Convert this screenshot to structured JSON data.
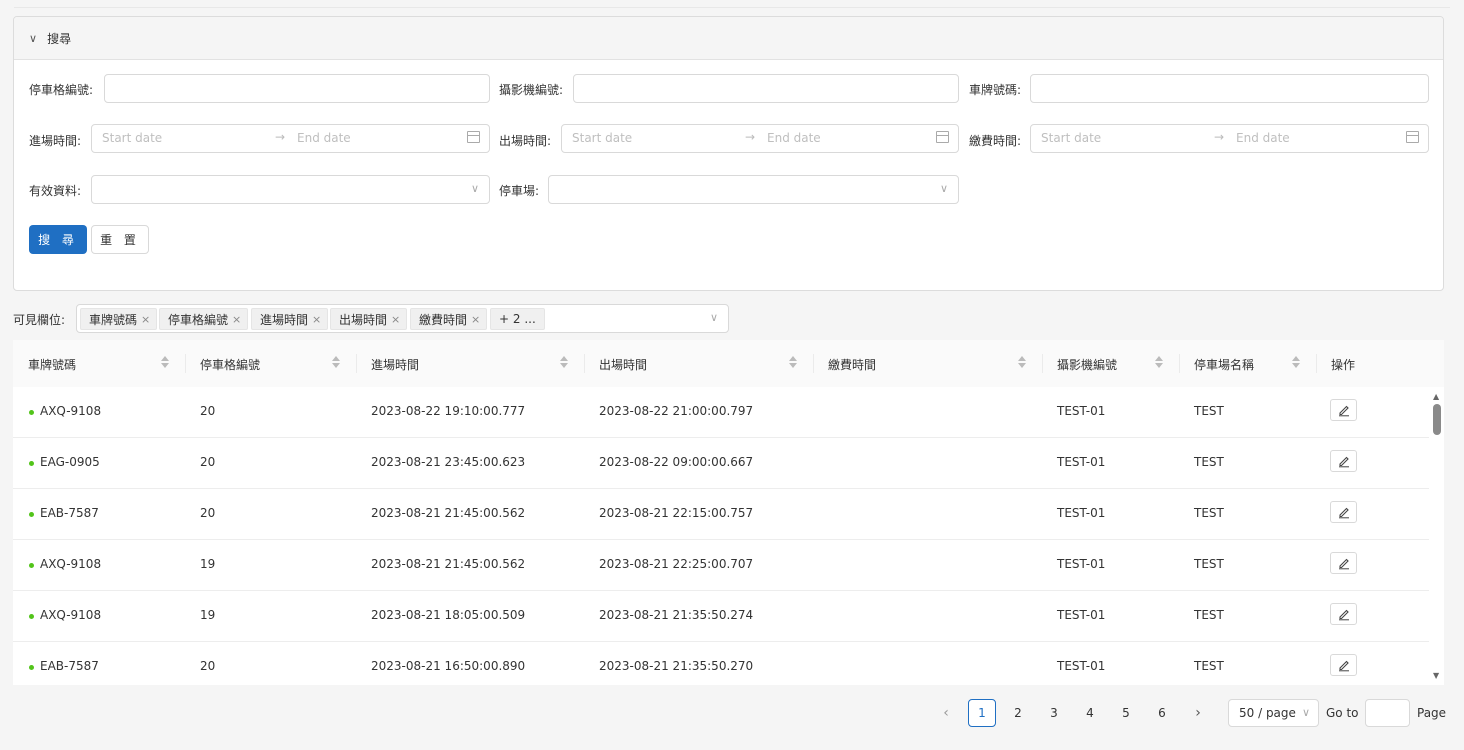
{
  "search": {
    "title": "搜尋",
    "fields": {
      "space_no": {
        "label": "停車格編號:",
        "value": ""
      },
      "camera_no": {
        "label": "攝影機編號:",
        "value": ""
      },
      "plate_no": {
        "label": "車牌號碼:",
        "value": ""
      },
      "enter_time": {
        "label": "進場時間:",
        "start_placeholder": "Start date",
        "end_placeholder": "End date"
      },
      "exit_time": {
        "label": "出場時間:",
        "start_placeholder": "Start date",
        "end_placeholder": "End date"
      },
      "pay_time": {
        "label": "繳費時間:",
        "start_placeholder": "Start date",
        "end_placeholder": "End date"
      },
      "valid_data": {
        "label": "有效資料:",
        "value": ""
      },
      "parking_lot": {
        "label": "停車場:",
        "value": ""
      }
    },
    "search_button": "搜 尋",
    "reset_button": "重 置"
  },
  "visible_columns": {
    "label": "可見欄位:",
    "tags": [
      "車牌號碼",
      "停車格編號",
      "進場時間",
      "出場時間",
      "繳費時間"
    ],
    "more": "+ 2 ..."
  },
  "table": {
    "headers": [
      "車牌號碼",
      "停車格編號",
      "進場時間",
      "出場時間",
      "繳費時間",
      "攝影機編號",
      "停車場名稱",
      "操作"
    ],
    "rows": [
      {
        "plate": "AXQ-9108",
        "space": "20",
        "enter": "2023-08-22 19:10:00.777",
        "exit": "2023-08-22 21:00:00.797",
        "pay": "",
        "camera": "TEST-01",
        "lot": "TEST"
      },
      {
        "plate": "EAG-0905",
        "space": "20",
        "enter": "2023-08-21 23:45:00.623",
        "exit": "2023-08-22 09:00:00.667",
        "pay": "",
        "camera": "TEST-01",
        "lot": "TEST"
      },
      {
        "plate": "EAB-7587",
        "space": "20",
        "enter": "2023-08-21 21:45:00.562",
        "exit": "2023-08-21 22:15:00.757",
        "pay": "",
        "camera": "TEST-01",
        "lot": "TEST"
      },
      {
        "plate": "AXQ-9108",
        "space": "19",
        "enter": "2023-08-21 21:45:00.562",
        "exit": "2023-08-21 22:25:00.707",
        "pay": "",
        "camera": "TEST-01",
        "lot": "TEST"
      },
      {
        "plate": "AXQ-9108",
        "space": "19",
        "enter": "2023-08-21 18:05:00.509",
        "exit": "2023-08-21 21:35:50.274",
        "pay": "",
        "camera": "TEST-01",
        "lot": "TEST"
      },
      {
        "plate": "EAB-7587",
        "space": "20",
        "enter": "2023-08-21 16:50:00.890",
        "exit": "2023-08-21 21:35:50.270",
        "pay": "",
        "camera": "TEST-01",
        "lot": "TEST"
      }
    ],
    "status_color": "#52c41a"
  },
  "pagination": {
    "prev": "‹",
    "next": "›",
    "pages": [
      "1",
      "2",
      "3",
      "4",
      "5",
      "6"
    ],
    "current": "1",
    "page_size": "50 / page",
    "goto_label": "Go to",
    "page_label": "Page",
    "goto_value": ""
  },
  "colors": {
    "primary": "#1f6fc3",
    "status_green": "#52c41a"
  }
}
